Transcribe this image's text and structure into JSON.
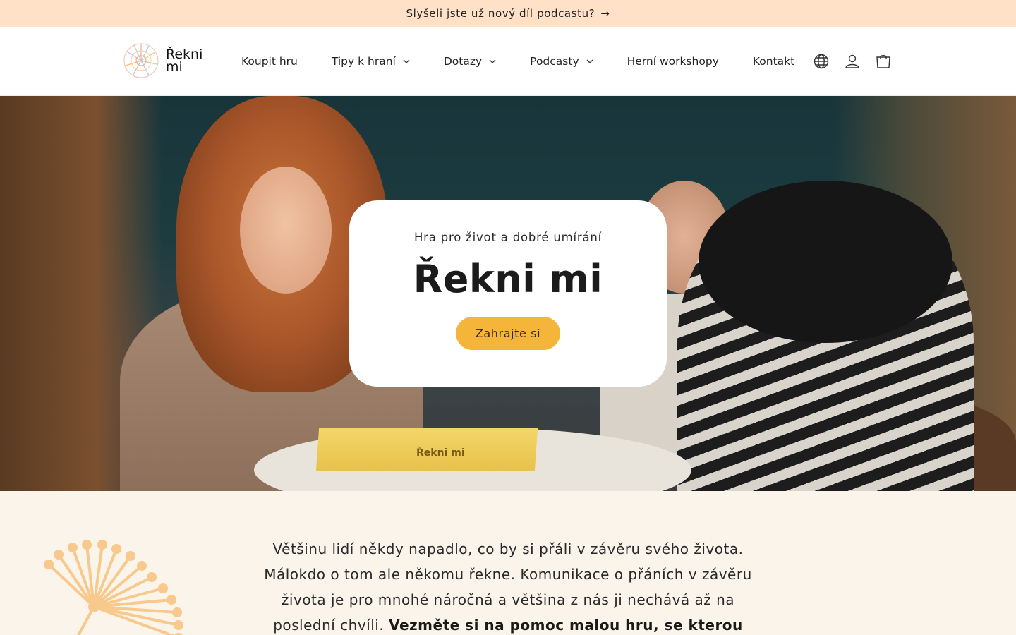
{
  "announcement": {
    "text": "Slyšeli jste už nový díl podcastu?",
    "arrow": "→"
  },
  "logo": {
    "line1": "Řekni",
    "line2": "mi"
  },
  "nav": [
    {
      "label": "Koupit hru",
      "dropdown": false
    },
    {
      "label": "Tipy k hraní",
      "dropdown": true
    },
    {
      "label": "Dotazy",
      "dropdown": true
    },
    {
      "label": "Podcasty",
      "dropdown": true
    },
    {
      "label": "Herní workshopy",
      "dropdown": false
    },
    {
      "label": "Kontakt",
      "dropdown": false
    }
  ],
  "header_icons": [
    "globe-icon",
    "account-icon",
    "cart-icon"
  ],
  "hero": {
    "subtitle": "Hra pro život a dobré umírání",
    "title": "Řekni mi",
    "cta": "Zahrajte si",
    "box_label": "Řekni mi"
  },
  "intro": {
    "text": "Většinu lidí někdy napadlo, co by si přáli v závěru svého života. Málokdo o tom ale někomu řekne. Komunikace o přáních v závěru života je pro mnohé náročná a většina z nás ji nechává až na poslední chvíli.",
    "bold": "Vezměte si na pomoc malou hru, se kterou"
  },
  "colors": {
    "announcement_bg": "#ffe1c8",
    "accent": "#f5b53b",
    "section_bg": "#faf4ea",
    "dandelion": "#f7c98c"
  }
}
